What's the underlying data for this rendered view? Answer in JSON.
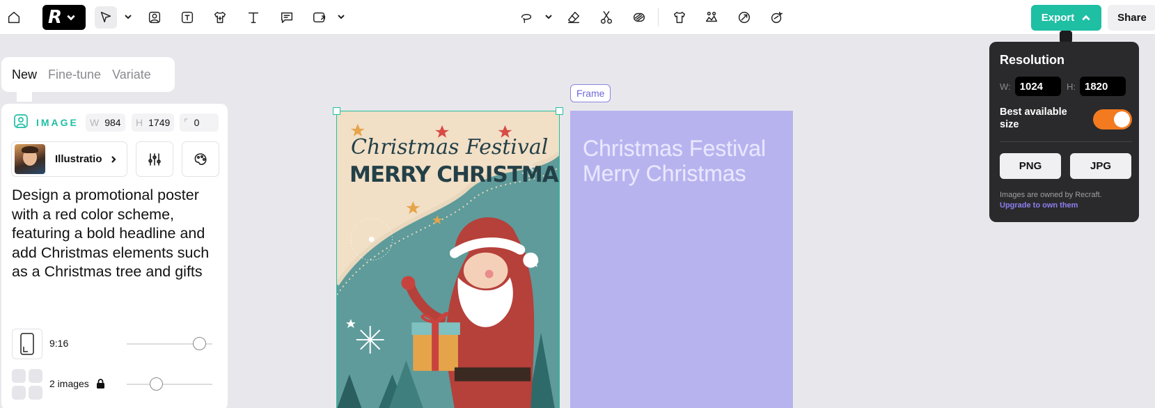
{
  "toolbar": {
    "left_tools": [
      "home-icon",
      "logo",
      "select-tool-icon",
      "image-tool-icon",
      "text-in-image-icon",
      "mockup-icon",
      "text-tool-icon",
      "comment-icon",
      "upload-icon"
    ],
    "center_tools": [
      "lasso-icon",
      "eraser-icon",
      "scissors-icon",
      "vectorize-icon",
      "tshirt-icon",
      "expand-icon",
      "inpaint-icon",
      "retouch-icon"
    ],
    "export_label": "Export",
    "share_label": "Share"
  },
  "tabs": {
    "new": "New",
    "fine_tune": "Fine-tune",
    "variate": "Variate"
  },
  "panel": {
    "type_label": "IMAGE",
    "width_key": "W",
    "width_value": "984",
    "height_key": "H",
    "height_value": "1749",
    "corner_value": "0",
    "style_name": "Illustratio",
    "prompt": "Design a promotional poster with a red color scheme, featuring a bold headline and add Christmas elements such as a Christmas tree and gifts",
    "ratio_label": "9:16",
    "ratio_slider": 0.85,
    "count_label": "2 images",
    "count_slider": 0.35
  },
  "canvas": {
    "poster_line1": "Christmas Festival",
    "poster_line2": "MERRY CHRISTMAS",
    "frame_label": "Frame",
    "frame_line1": "Christmas Festival",
    "frame_line2": "Merry Christmas"
  },
  "export_popover": {
    "title": "Resolution",
    "w_key": "W:",
    "w_value": "1024",
    "h_key": "H:",
    "h_value": "1820",
    "best_size_label": "Best available size",
    "best_size_on": true,
    "png_label": "PNG",
    "jpg_label": "JPG",
    "note": "Images are owned by Recraft.",
    "upgrade_link": "Upgrade to own them"
  },
  "colors": {
    "accent": "#1fbfa4",
    "toggle_on": "#f37a1f",
    "frame_fill": "#b7b3ee",
    "link": "#8b7ff0"
  }
}
